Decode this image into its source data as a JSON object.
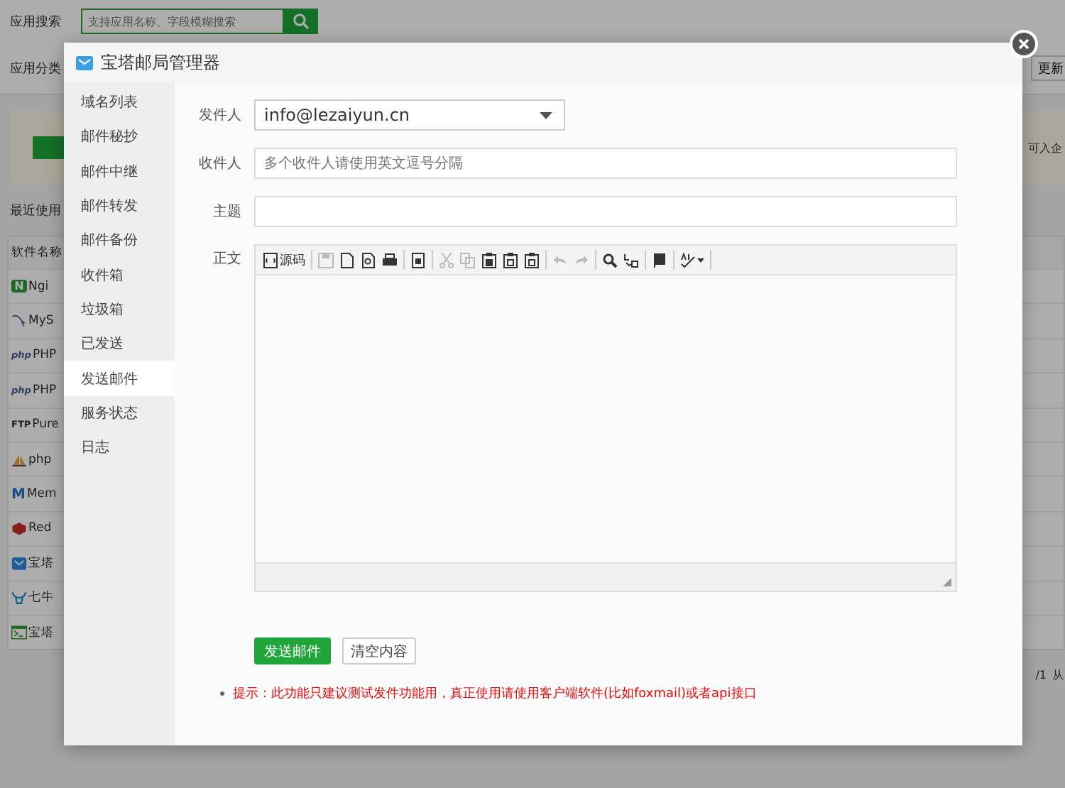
{
  "background": {
    "search_label": "应用搜索",
    "search_placeholder": "支持应用名称、字段模糊搜索",
    "category_label": "应用分类",
    "update_button": "更新",
    "banner_text": "可入企",
    "recent_label": "最近使用",
    "table_header": "软件名称",
    "rows": [
      {
        "kind": "nginx",
        "logo": "N",
        "name": "Ngi"
      },
      {
        "kind": "mysql",
        "name": "MyS"
      },
      {
        "kind": "php",
        "logo": "php",
        "name": "PHP"
      },
      {
        "kind": "php",
        "logo": "php",
        "name": "PHP"
      },
      {
        "kind": "ftp",
        "logo": "FTP",
        "name": "Pure"
      },
      {
        "kind": "phpmyadmin",
        "name": "php"
      },
      {
        "kind": "memcached",
        "logo": "M",
        "name": "Mem"
      },
      {
        "kind": "redis",
        "name": "Red"
      },
      {
        "kind": "mail",
        "name": "宝塔"
      },
      {
        "kind": "qiniu",
        "name": "七牛"
      },
      {
        "kind": "terminal",
        "name": "宝塔"
      }
    ],
    "pager": [
      "/1",
      "从"
    ]
  },
  "modal": {
    "title": "宝塔邮局管理器",
    "sidebar": [
      {
        "label": "域名列表",
        "selected": false
      },
      {
        "label": "邮件秘抄",
        "selected": false
      },
      {
        "label": "邮件中继",
        "selected": false
      },
      {
        "label": "邮件转发",
        "selected": false
      },
      {
        "label": "邮件备份",
        "selected": false
      },
      {
        "label": "收件箱",
        "selected": false
      },
      {
        "label": "垃圾箱",
        "selected": false
      },
      {
        "label": "已发送",
        "selected": false
      },
      {
        "label": "发送邮件",
        "selected": true
      },
      {
        "label": "服务状态",
        "selected": false
      },
      {
        "label": "日志",
        "selected": false
      }
    ],
    "form": {
      "sender_label": "发件人",
      "sender_value": "info@lezaiyun.cn",
      "recipient_label": "收件人",
      "recipient_placeholder": "多个收件人请使用英文逗号分隔",
      "subject_label": "主题",
      "body_label": "正文",
      "tools": [
        {
          "kind": "source",
          "label": "源码",
          "disabled": false
        },
        {
          "kind": "sep"
        },
        {
          "kind": "save",
          "disabled": true
        },
        {
          "kind": "new",
          "disabled": false
        },
        {
          "kind": "preview",
          "disabled": false
        },
        {
          "kind": "print",
          "disabled": false
        },
        {
          "kind": "sep"
        },
        {
          "kind": "template",
          "disabled": false
        },
        {
          "kind": "sep"
        },
        {
          "kind": "cut",
          "disabled": true
        },
        {
          "kind": "copy",
          "disabled": true
        },
        {
          "kind": "paste",
          "disabled": false
        },
        {
          "kind": "paste-text",
          "disabled": false
        },
        {
          "kind": "paste-word",
          "disabled": false
        },
        {
          "kind": "sep"
        },
        {
          "kind": "undo",
          "disabled": true
        },
        {
          "kind": "redo",
          "disabled": true
        },
        {
          "kind": "sep"
        },
        {
          "kind": "find",
          "disabled": false
        },
        {
          "kind": "replace",
          "disabled": false
        },
        {
          "kind": "sep"
        },
        {
          "kind": "block",
          "disabled": false
        },
        {
          "kind": "sep"
        },
        {
          "kind": "spell",
          "disabled": false
        },
        {
          "kind": "sep"
        }
      ],
      "send_button": "发送邮件",
      "clear_button": "清空内容",
      "tip": "提示：此功能只建议测试发件功能用，真正使用请使用客户端软件(比如foxmail)或者api接口"
    }
  }
}
